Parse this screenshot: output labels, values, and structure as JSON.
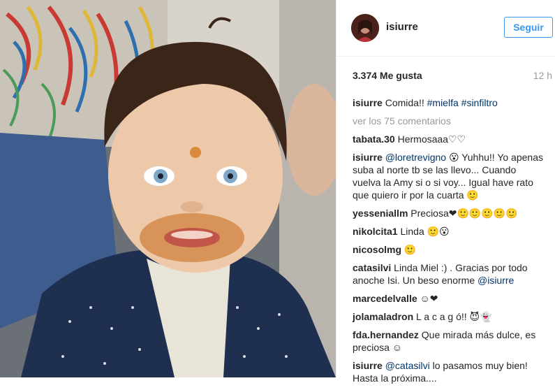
{
  "post": {
    "username": "isiurre",
    "follow_label": "Seguir",
    "likes": "3.374 Me gusta",
    "time": "12 h"
  },
  "caption": {
    "user": "isiurre",
    "text": "Comida!!",
    "tag1": "#mielfa",
    "tag2": "#sinfiltro"
  },
  "view_more": "ver los 75 comentarios",
  "comments": [
    {
      "user": "tabata.30",
      "text": "Hermosaaa♡♡"
    },
    {
      "user": "isiurre",
      "mention": "@loretrevigno",
      "text": "😮 Yuhhu!! Yo apenas suba al norte tb se las llevo... Cuando vuelva la Amy si o si voy... Igual have rato que quiero ir por la cuarta 🙂"
    },
    {
      "user": "yesseniallm",
      "text": "Preciosa❤🙂🙂🙂🙂🙂"
    },
    {
      "user": "nikolcita1",
      "text": "Linda 🙂😮"
    },
    {
      "user": "nicosolmg",
      "text": "🙂"
    },
    {
      "user": "catasilvi",
      "text": "Linda Miel :) . Gracias por todo anoche Isi. Un beso enorme",
      "mention": "@isiurre"
    },
    {
      "user": "marcedelvalle",
      "text": "☺❤"
    },
    {
      "user": "jolamaladron",
      "text": "L a c a g ó!! 😈👻"
    },
    {
      "user": "fda.hernandez",
      "text": "Que mirada más dulce, es preciosa ☺"
    },
    {
      "user": "isiurre",
      "mention": "@catasilvi",
      "text": "lo pasamos muy bien! Hasta la próxima...."
    }
  ],
  "colors": {
    "accent": "#3897f0",
    "link": "#003569",
    "muted": "#999999"
  }
}
